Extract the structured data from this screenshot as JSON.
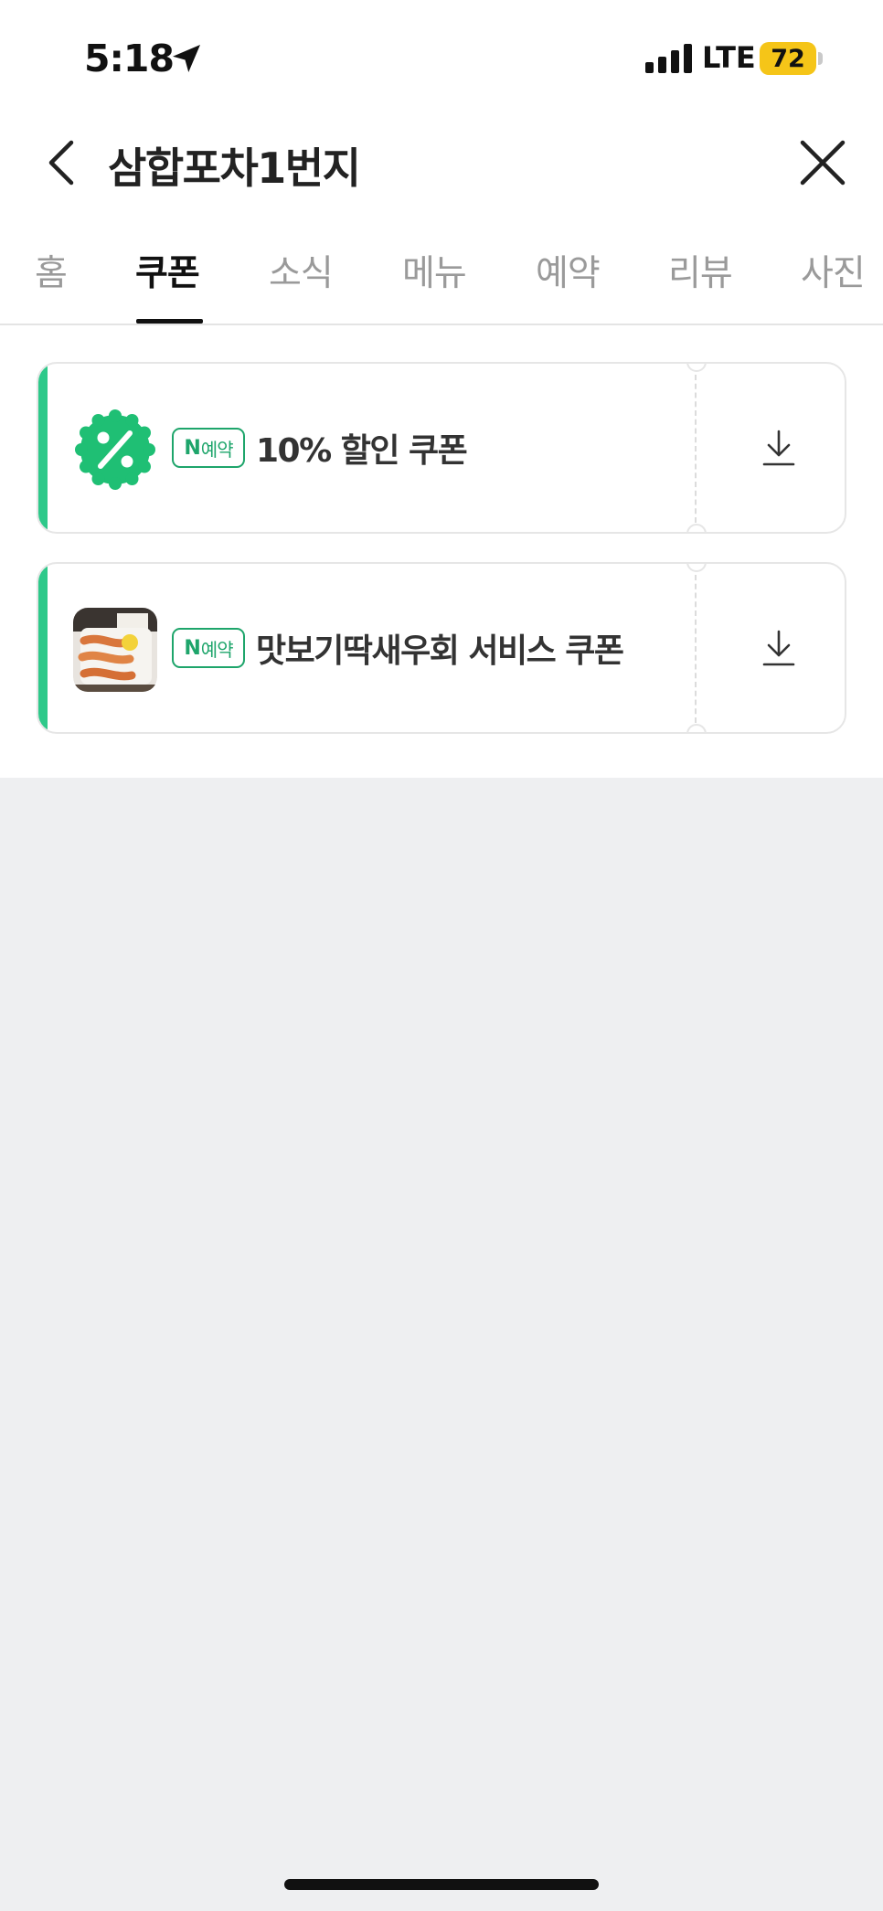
{
  "status_bar": {
    "time": "5:18",
    "network": "LTE",
    "battery": "72"
  },
  "header": {
    "title": "삼합포차1번지",
    "back_icon": "chevron-left-icon",
    "close_icon": "close-icon"
  },
  "tabs": [
    {
      "label": "홈",
      "active": false
    },
    {
      "label": "쿠폰",
      "active": true
    },
    {
      "label": "소식",
      "active": false
    },
    {
      "label": "메뉴",
      "active": false
    },
    {
      "label": "예약",
      "active": false
    },
    {
      "label": "리뷰",
      "active": false
    },
    {
      "label": "사진",
      "active": false
    }
  ],
  "coupons": [
    {
      "badge_prefix": "N",
      "badge_text": "예약",
      "title": "10% 할인 쿠폰",
      "icon": "percent-badge-icon"
    },
    {
      "badge_prefix": "N",
      "badge_text": "예약",
      "title": "맛보기딱새우회 서비스 쿠폰",
      "icon": "shrimp-photo"
    }
  ],
  "colors": {
    "accent": "#2ec98a",
    "badge": "#1ea56b",
    "battery": "#f5c518",
    "background": "#eeeff1"
  }
}
